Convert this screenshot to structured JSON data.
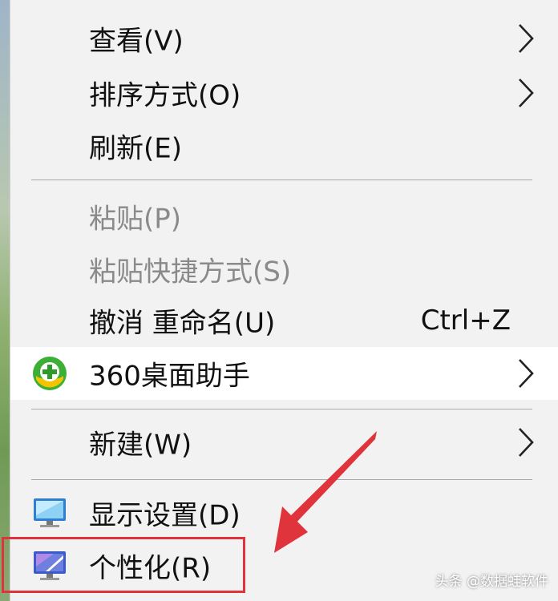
{
  "context_menu": {
    "items": [
      {
        "label": "查看(V)",
        "has_submenu": true
      },
      {
        "label": "排序方式(O)",
        "has_submenu": true
      },
      {
        "label": "刷新(E)"
      },
      {
        "label": "粘贴(P)",
        "disabled": true
      },
      {
        "label": "粘贴快捷方式(S)",
        "disabled": true
      },
      {
        "label": "撤消 重命名(U)",
        "shortcut": "Ctrl+Z"
      },
      {
        "label": "360桌面助手",
        "has_submenu": true,
        "icon": "360-plus-icon",
        "highlighted": true
      },
      {
        "label": "新建(W)",
        "has_submenu": true
      },
      {
        "label": "显示设置(D)",
        "icon": "monitor-icon"
      },
      {
        "label": "个性化(R)",
        "icon": "personalize-monitor-icon",
        "annotated": true
      }
    ]
  },
  "annotation": {
    "color": "#e0343c"
  },
  "watermark": {
    "text": "头条 @数据蛙软件"
  }
}
